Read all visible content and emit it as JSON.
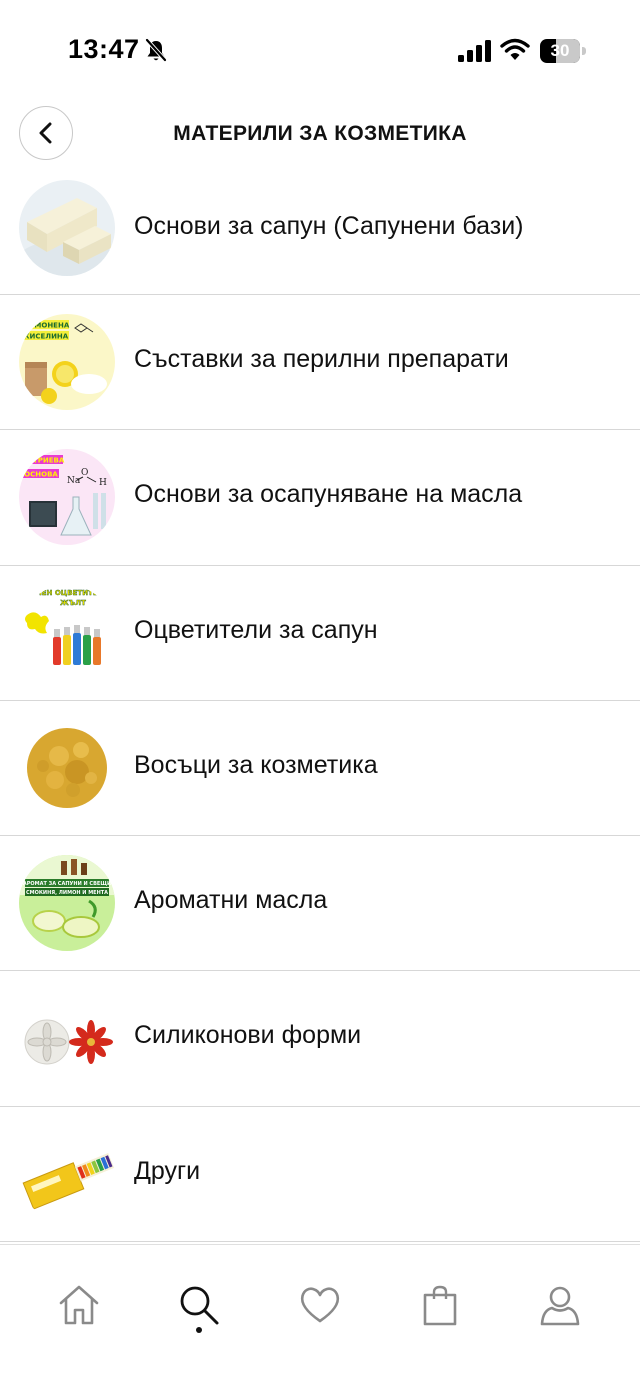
{
  "status_bar": {
    "time": "13:47",
    "battery": "30",
    "icons": [
      "bell-off-icon",
      "signal-icon",
      "wifi-icon",
      "battery-icon"
    ]
  },
  "header": {
    "title": "МАТЕРИЛИ ЗА КОЗМЕТИКА",
    "back_icon": "chevron-left-icon"
  },
  "categories": [
    {
      "label": "Основи за сапун (Сапунени бази)"
    },
    {
      "label": "Съставки за перилни препарати",
      "thumb_text": [
        "ЛИМОНЕНА",
        "КИСЕЛИНА"
      ]
    },
    {
      "label": "Основи за осапуняване на масла",
      "thumb_text": [
        "НАТРИЕВА",
        "ОСНОВА",
        "Na",
        "O",
        "H"
      ]
    },
    {
      "label": "Оцветители за сапун",
      "thumb_text": [
        "ТЕЧЕН ОЦВЕТИТЕЛ",
        "ЖЪЛТ"
      ]
    },
    {
      "label": "Восъци за козметика"
    },
    {
      "label": "Ароматни масла",
      "thumb_text": [
        "АРОМАТ ЗА САПУНИ И СВЕЩИ",
        "СМОКИНЯ, ЛИМОН И МЕНТА"
      ]
    },
    {
      "label": "Силиконови форми"
    },
    {
      "label": "Други"
    }
  ],
  "bottom_nav": {
    "items": [
      "home-icon",
      "search-icon",
      "heart-icon",
      "shopping-bag-icon",
      "profile-icon"
    ],
    "active": "search-icon"
  },
  "colors": {
    "divider": "#d7d7d7",
    "text": "#111111",
    "icon_gray": "#8a8a8a"
  }
}
